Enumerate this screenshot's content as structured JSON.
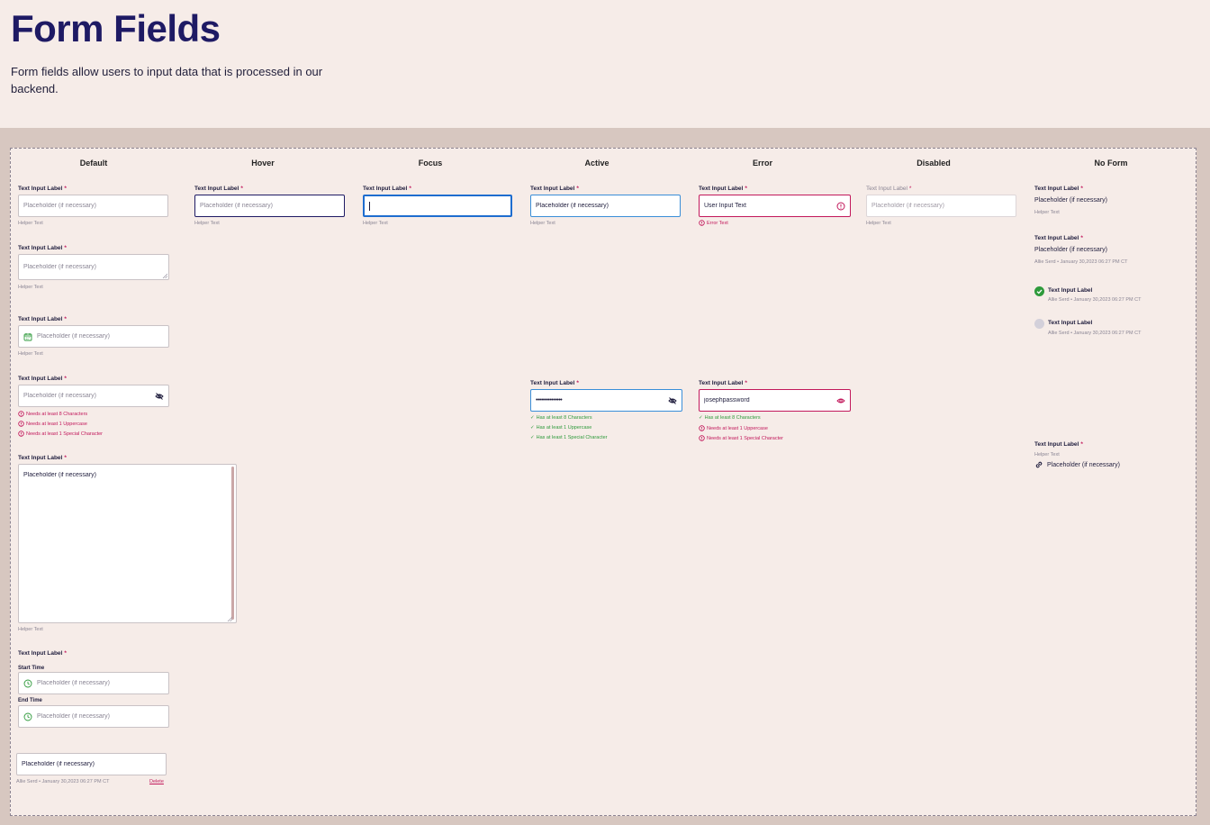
{
  "page": {
    "title": "Form Fields",
    "subtitle": "Form fields allow users to input data that is processed in our backend."
  },
  "columns": [
    "Default",
    "Hover",
    "Focus",
    "Active",
    "Error",
    "Disabled",
    "No Form"
  ],
  "field": {
    "label": "Text Input Label",
    "required_mark": "*",
    "placeholder": "Placeholder (if necessary)",
    "helper": "Helper Text"
  },
  "states": {
    "error_value": "User Input Text",
    "error_message": "Error Text",
    "password_masked": "•••••••••••••••",
    "password_plain": "josephpassword"
  },
  "password_rules": {
    "need": [
      "Needs at least 8 Characters",
      "Needs at least 1 Uppercase",
      "Needs at least 1 Special Character"
    ],
    "has": [
      "Has at least 8 Characters",
      "Has at least 1 Uppercase",
      "Has at least 1 Special Character"
    ]
  },
  "time_range": {
    "start_label": "Start Time",
    "end_label": "End Time"
  },
  "comment": {
    "value": "Placeholder (if necessary)",
    "meta": "Allie Serd • January 30,2023 06:27 PM CT",
    "delete_label": "Delete"
  },
  "no_form": {
    "meta": "Allie Serd • January 30,2023 06:27 PM CT"
  },
  "colors": {
    "title": "#1e1a64",
    "required": "#c2185b",
    "success": "#2e9a3b",
    "focus": "#1e6dcf",
    "active": "#3a8ed8",
    "stage": "#d7c7c0",
    "canvas": "#f6ece8"
  },
  "icons": [
    "calendar-icon",
    "eye-off-icon",
    "eye-icon",
    "alert-circle-icon",
    "check-icon",
    "clock-icon",
    "link-icon",
    "check-circle-icon"
  ]
}
